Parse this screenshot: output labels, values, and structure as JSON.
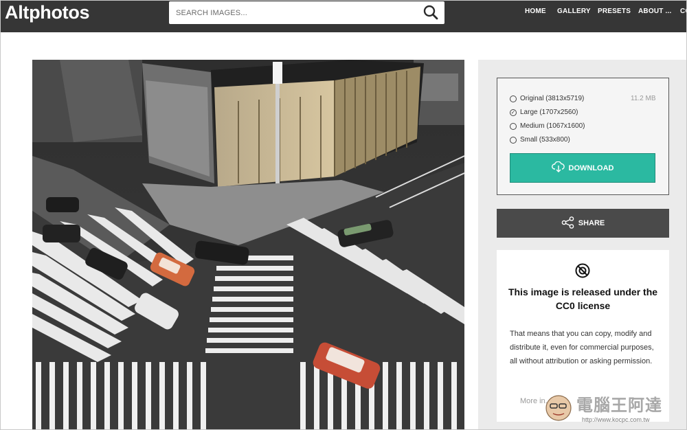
{
  "header": {
    "logo": "Altphotos",
    "search_placeholder": "SEARCH IMAGES...",
    "nav": [
      "HOME",
      "GALLERY",
      "PRESETS",
      "ABOUT ...",
      "CO"
    ]
  },
  "download": {
    "options": [
      {
        "label": "Original (3813x5719)",
        "selected": false
      },
      {
        "label": "Large (1707x2560)",
        "selected": true
      },
      {
        "label": "Medium (1067x1600)",
        "selected": false
      },
      {
        "label": "Small (533x800)",
        "selected": false
      }
    ],
    "size_note": "11.2 MB",
    "button": "DOWNLOAD"
  },
  "share": {
    "button": "SHARE"
  },
  "license": {
    "title": "This image is released under the CC0 license",
    "body": "That means that you can copy, modify and distribute it, even for commercial purposes, all without attribution or asking permission.",
    "more": "More in..."
  },
  "watermark": {
    "text": "電腦王阿達",
    "url": "http://www.kocpc.com.tw"
  },
  "colors": {
    "topbar": "#363636",
    "accent": "#2bb9a1",
    "share": "#4a4a4a"
  }
}
